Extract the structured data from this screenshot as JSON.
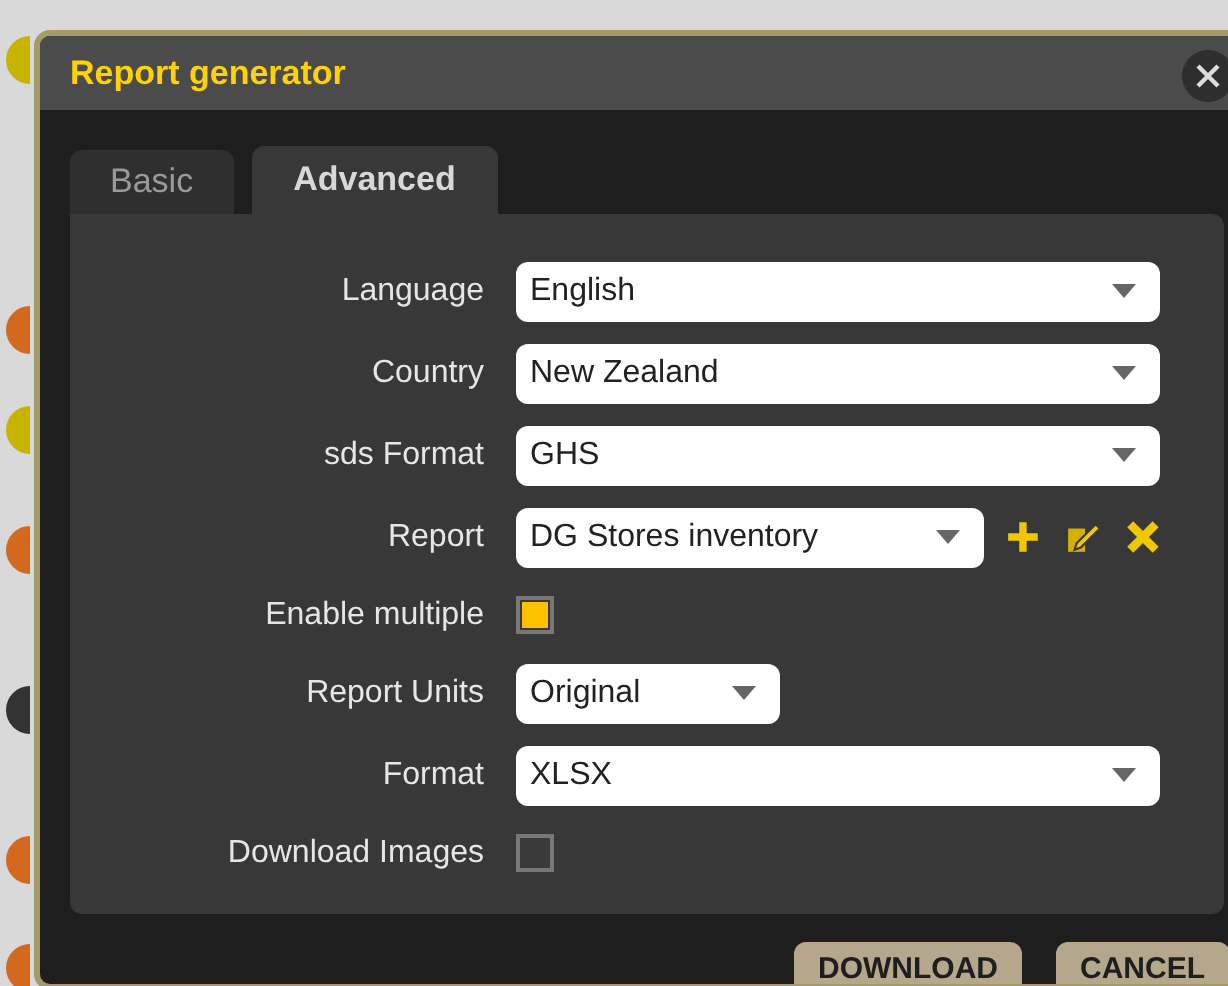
{
  "background": {
    "badges": [
      {
        "color": "#c8b400"
      },
      {
        "color": "#d2691e"
      },
      {
        "color": "#c8b400"
      },
      {
        "color": "#d2691e"
      },
      {
        "color": "#333333"
      },
      {
        "color": "#d2691e"
      },
      {
        "color": "#d2691e"
      }
    ]
  },
  "dialog": {
    "title": "Report generator",
    "tabs": [
      {
        "label": "Basic",
        "selected": false
      },
      {
        "label": "Advanced",
        "selected": true
      }
    ],
    "fields": [
      {
        "kind": "select",
        "label": "Language",
        "value": "English"
      },
      {
        "kind": "select",
        "label": "Country",
        "value": "New Zealand"
      },
      {
        "kind": "select",
        "label": "sds Format",
        "value": "GHS"
      },
      {
        "kind": "select",
        "label": "Report",
        "value": "DG Stores inventory",
        "actions": true
      },
      {
        "kind": "checkbox",
        "label": "Enable multiple",
        "checked": true
      },
      {
        "kind": "short-select",
        "label": "Report Units",
        "value": "Original"
      },
      {
        "kind": "select",
        "label": "Format",
        "value": "XLSX"
      },
      {
        "kind": "checkbox",
        "label": "Download Images",
        "checked": false
      }
    ],
    "buttons": [
      "DOWNLOAD",
      "CANCEL"
    ]
  }
}
